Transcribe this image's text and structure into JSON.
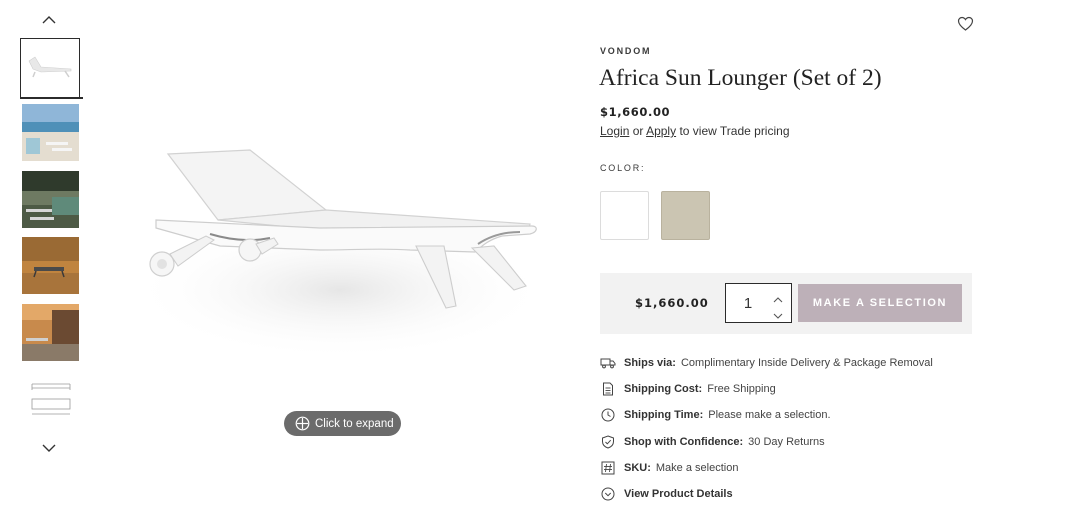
{
  "gallery": {
    "thumbnails": [
      {
        "label": "white lounger",
        "selected": true
      },
      {
        "label": "beach scene",
        "selected": false
      },
      {
        "label": "poolside scene",
        "selected": false
      },
      {
        "label": "terrace scene",
        "selected": false
      },
      {
        "label": "sunset pool scene",
        "selected": false
      },
      {
        "label": "dimension drawing",
        "selected": false
      }
    ],
    "expand_label": "Click to expand"
  },
  "product": {
    "brand": "VONDOM",
    "title": "Africa Sun Lounger (Set of 2)",
    "price": "$1,660.00",
    "trade": {
      "login": "Login",
      "or": "or",
      "apply": "Apply",
      "suffix": "to view Trade pricing"
    },
    "color_label": "COLOR:",
    "swatches": [
      {
        "name": "White",
        "hex": "#ffffff"
      },
      {
        "name": "Taupe",
        "hex": "#cbc5b2"
      }
    ]
  },
  "purchase": {
    "price": "$1,660.00",
    "quantity": "1",
    "button_label": "MAKE A SELECTION",
    "button_color": "#bdb0b8"
  },
  "details": [
    {
      "icon": "truck-icon",
      "key": "Ships via:",
      "value": "Complimentary Inside Delivery & Package Removal"
    },
    {
      "icon": "document-icon",
      "key": "Shipping Cost:",
      "value": "Free Shipping"
    },
    {
      "icon": "clock-icon",
      "key": "Shipping Time:",
      "value": "Please make a selection."
    },
    {
      "icon": "shield-check-icon",
      "key": "Shop with Confidence:",
      "value": "30 Day Returns"
    },
    {
      "icon": "hash-icon",
      "key": "SKU:",
      "value": "Make a selection"
    },
    {
      "icon": "chevron-circle-icon",
      "key": "View Product Details",
      "value": ""
    }
  ]
}
